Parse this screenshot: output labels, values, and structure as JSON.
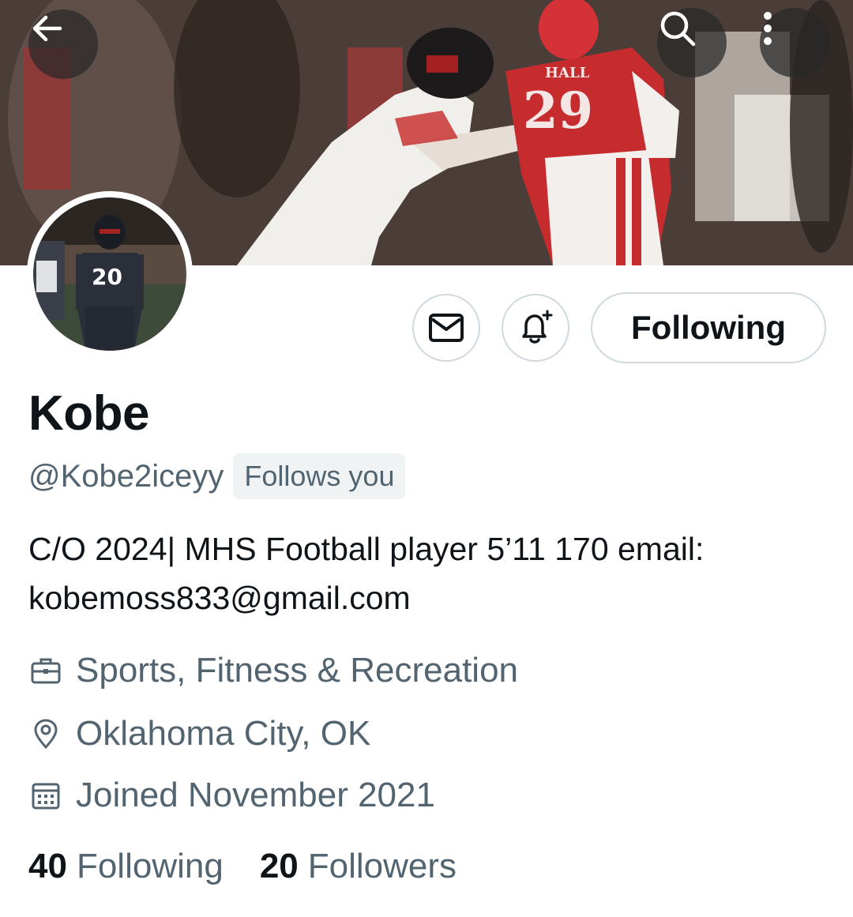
{
  "header": {
    "back_icon": "arrow-left-icon",
    "search_icon": "search-icon",
    "more_icon": "more-vertical-icon",
    "banner": {
      "left_jersey_number": "",
      "right_jersey_name": "HALL",
      "right_jersey_number": "29"
    }
  },
  "profile": {
    "avatar_jersey_number": "20",
    "name": "Kobe",
    "handle": "@Kobe2iceyy",
    "follows_you": "Follows you",
    "bio_line1": "C/O 2024| MHS Football player 5’11 170 email:",
    "bio_line2": "kobemoss833@gmail.com",
    "category": "Sports, Fitness & Recreation",
    "location": "Oklahoma City, OK",
    "joined": "Joined November 2021"
  },
  "actions": {
    "message_icon": "envelope-icon",
    "notify_icon": "bell-plus-icon",
    "follow_label": "Following"
  },
  "stats": {
    "following_count": "40",
    "following_label": "Following",
    "followers_count": "20",
    "followers_label": "Followers"
  },
  "colors": {
    "text_primary": "#0f1419",
    "text_secondary": "#536471",
    "border": "#cfd9de",
    "badge_bg": "#eff3f4"
  }
}
